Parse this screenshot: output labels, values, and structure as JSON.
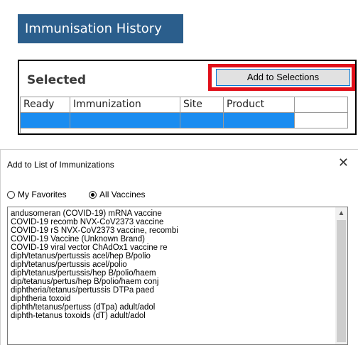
{
  "banner": {
    "title": "Immunisation History"
  },
  "selected_panel": {
    "title": "Selected",
    "add_button_label": "Add to Selections",
    "highlight_color": "#e0101a",
    "columns": [
      "Ready",
      "Immunization",
      "Site",
      "Product",
      ""
    ],
    "rows": [
      [
        "",
        "",
        "",
        "",
        ""
      ]
    ]
  },
  "dialog": {
    "title": "Add to List of Immunizations",
    "close_icon": "close-icon",
    "radio_options": [
      {
        "label": "My Favorites",
        "selected": false
      },
      {
        "label": "All Vaccines",
        "selected": true
      }
    ],
    "vaccines": [
      "andusomeran (COVID-19) mRNA vaccine",
      "COVID-19 recomb NVX-CoV2373 vaccine",
      "COVID-19 rS NVX-CoV2373 vaccine, recombi",
      "COVID-19 Vaccine (Unknown Brand)",
      "COVID-19 viral vector ChAdOx1 vaccine re",
      "diph/tetanus/pertussis acel/hep B/polio",
      "diph/tetanus/pertussis acel/polio",
      "diph/tetanus/pertussis/hep B/polio/haem",
      "dip/tetanus/pertus/hep B/polio/haem conj",
      "diphtheria/tetanus/pertussis DTPa paed",
      "diphtheria toxoid",
      "diphth/tetanus/pertuss (dTpa) adult/adol",
      "diphth-tetanus toxoids (dT) adult/adol"
    ]
  }
}
